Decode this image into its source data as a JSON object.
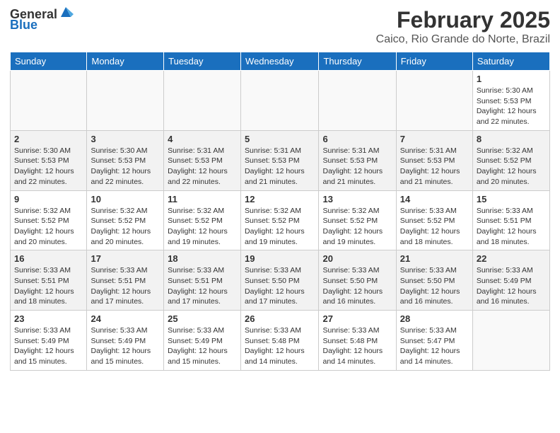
{
  "header": {
    "logo": {
      "general": "General",
      "blue": "Blue"
    },
    "title": "February 2025",
    "subtitle": "Caico, Rio Grande do Norte, Brazil"
  },
  "days_of_week": [
    "Sunday",
    "Monday",
    "Tuesday",
    "Wednesday",
    "Thursday",
    "Friday",
    "Saturday"
  ],
  "weeks": [
    {
      "row": 0,
      "cells": [
        {
          "day": "",
          "info": ""
        },
        {
          "day": "",
          "info": ""
        },
        {
          "day": "",
          "info": ""
        },
        {
          "day": "",
          "info": ""
        },
        {
          "day": "",
          "info": ""
        },
        {
          "day": "",
          "info": ""
        },
        {
          "day": "1",
          "info": "Sunrise: 5:30 AM\nSunset: 5:53 PM\nDaylight: 12 hours and 22 minutes."
        }
      ]
    },
    {
      "row": 1,
      "cells": [
        {
          "day": "2",
          "info": "Sunrise: 5:30 AM\nSunset: 5:53 PM\nDaylight: 12 hours and 22 minutes."
        },
        {
          "day": "3",
          "info": "Sunrise: 5:30 AM\nSunset: 5:53 PM\nDaylight: 12 hours and 22 minutes."
        },
        {
          "day": "4",
          "info": "Sunrise: 5:31 AM\nSunset: 5:53 PM\nDaylight: 12 hours and 22 minutes."
        },
        {
          "day": "5",
          "info": "Sunrise: 5:31 AM\nSunset: 5:53 PM\nDaylight: 12 hours and 21 minutes."
        },
        {
          "day": "6",
          "info": "Sunrise: 5:31 AM\nSunset: 5:53 PM\nDaylight: 12 hours and 21 minutes."
        },
        {
          "day": "7",
          "info": "Sunrise: 5:31 AM\nSunset: 5:53 PM\nDaylight: 12 hours and 21 minutes."
        },
        {
          "day": "8",
          "info": "Sunrise: 5:32 AM\nSunset: 5:52 PM\nDaylight: 12 hours and 20 minutes."
        }
      ]
    },
    {
      "row": 2,
      "cells": [
        {
          "day": "9",
          "info": "Sunrise: 5:32 AM\nSunset: 5:52 PM\nDaylight: 12 hours and 20 minutes."
        },
        {
          "day": "10",
          "info": "Sunrise: 5:32 AM\nSunset: 5:52 PM\nDaylight: 12 hours and 20 minutes."
        },
        {
          "day": "11",
          "info": "Sunrise: 5:32 AM\nSunset: 5:52 PM\nDaylight: 12 hours and 19 minutes."
        },
        {
          "day": "12",
          "info": "Sunrise: 5:32 AM\nSunset: 5:52 PM\nDaylight: 12 hours and 19 minutes."
        },
        {
          "day": "13",
          "info": "Sunrise: 5:32 AM\nSunset: 5:52 PM\nDaylight: 12 hours and 19 minutes."
        },
        {
          "day": "14",
          "info": "Sunrise: 5:33 AM\nSunset: 5:52 PM\nDaylight: 12 hours and 18 minutes."
        },
        {
          "day": "15",
          "info": "Sunrise: 5:33 AM\nSunset: 5:51 PM\nDaylight: 12 hours and 18 minutes."
        }
      ]
    },
    {
      "row": 3,
      "cells": [
        {
          "day": "16",
          "info": "Sunrise: 5:33 AM\nSunset: 5:51 PM\nDaylight: 12 hours and 18 minutes."
        },
        {
          "day": "17",
          "info": "Sunrise: 5:33 AM\nSunset: 5:51 PM\nDaylight: 12 hours and 17 minutes."
        },
        {
          "day": "18",
          "info": "Sunrise: 5:33 AM\nSunset: 5:51 PM\nDaylight: 12 hours and 17 minutes."
        },
        {
          "day": "19",
          "info": "Sunrise: 5:33 AM\nSunset: 5:50 PM\nDaylight: 12 hours and 17 minutes."
        },
        {
          "day": "20",
          "info": "Sunrise: 5:33 AM\nSunset: 5:50 PM\nDaylight: 12 hours and 16 minutes."
        },
        {
          "day": "21",
          "info": "Sunrise: 5:33 AM\nSunset: 5:50 PM\nDaylight: 12 hours and 16 minutes."
        },
        {
          "day": "22",
          "info": "Sunrise: 5:33 AM\nSunset: 5:49 PM\nDaylight: 12 hours and 16 minutes."
        }
      ]
    },
    {
      "row": 4,
      "cells": [
        {
          "day": "23",
          "info": "Sunrise: 5:33 AM\nSunset: 5:49 PM\nDaylight: 12 hours and 15 minutes."
        },
        {
          "day": "24",
          "info": "Sunrise: 5:33 AM\nSunset: 5:49 PM\nDaylight: 12 hours and 15 minutes."
        },
        {
          "day": "25",
          "info": "Sunrise: 5:33 AM\nSunset: 5:49 PM\nDaylight: 12 hours and 15 minutes."
        },
        {
          "day": "26",
          "info": "Sunrise: 5:33 AM\nSunset: 5:48 PM\nDaylight: 12 hours and 14 minutes."
        },
        {
          "day": "27",
          "info": "Sunrise: 5:33 AM\nSunset: 5:48 PM\nDaylight: 12 hours and 14 minutes."
        },
        {
          "day": "28",
          "info": "Sunrise: 5:33 AM\nSunset: 5:47 PM\nDaylight: 12 hours and 14 minutes."
        },
        {
          "day": "",
          "info": ""
        }
      ]
    }
  ]
}
